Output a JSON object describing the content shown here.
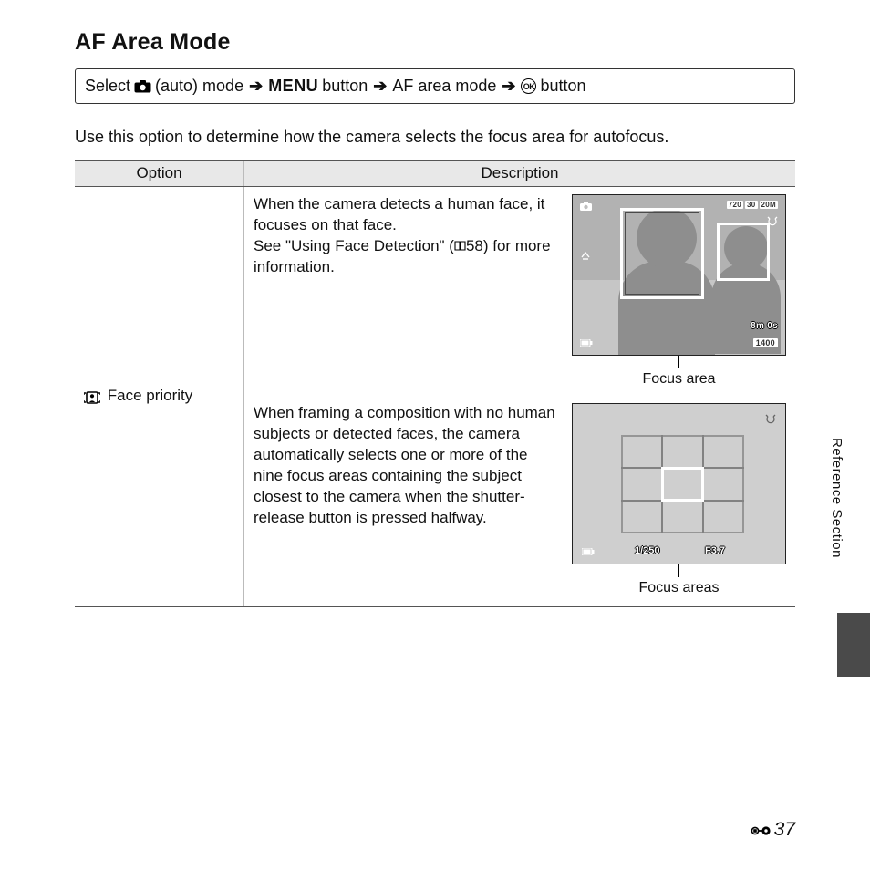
{
  "title": "AF Area Mode",
  "nav": {
    "select": "Select",
    "mode_suffix": "(auto) mode",
    "menu": "MENU",
    "button1": "button",
    "item": "AF area mode",
    "button2": "button"
  },
  "intro": "Use this option to determine how the camera selects the focus area for autofocus.",
  "table": {
    "headers": {
      "option": "Option",
      "description": "Description"
    },
    "row1": {
      "option_label": "Face priority",
      "desc1a": "When the camera detects a human face, it focuses on that face.",
      "desc1b_pre": "See \"Using Face Detection\" (",
      "desc1b_ref": "58",
      "desc1b_post": ") for more information.",
      "caption1": "Focus area",
      "desc2": "When framing a composition with no human subjects or detected faces, the camera automatically selects one or more of the nine focus areas containing the subject closest to the camera when the shutter-release button is pressed halfway.",
      "caption2": "Focus areas"
    }
  },
  "screen1_hud": {
    "rec1": "720",
    "rec2": "30",
    "rec3": "20M",
    "time": "8m 0s",
    "count": "1400"
  },
  "screen2_hud": {
    "shutter": "1/250",
    "aperture": "F3.7"
  },
  "side_label": "Reference Section",
  "page_number": "37"
}
